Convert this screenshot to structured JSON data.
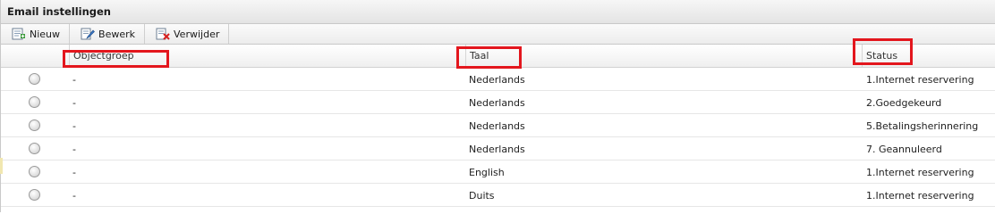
{
  "panel": {
    "title": "Email instellingen"
  },
  "toolbar": {
    "new_label": "Nieuw",
    "edit_label": "Bewerk",
    "delete_label": "Verwijder"
  },
  "columns": {
    "objectgroep": "Objectgroep",
    "taal": "Taal",
    "status": "Status"
  },
  "rows": [
    {
      "objectgroep": "-",
      "taal": "Nederlands",
      "status": "1.Internet reservering"
    },
    {
      "objectgroep": "-",
      "taal": "Nederlands",
      "status": "2.Goedgekeurd"
    },
    {
      "objectgroep": "-",
      "taal": "Nederlands",
      "status": "5.Betalingsherinnering"
    },
    {
      "objectgroep": "-",
      "taal": "Nederlands",
      "status": "7. Geannuleerd"
    },
    {
      "objectgroep": "-",
      "taal": "English",
      "status": "1.Internet reservering"
    },
    {
      "objectgroep": "-",
      "taal": "Duits",
      "status": "1.Internet reservering"
    }
  ],
  "colors": {
    "highlight": "#e3161d"
  }
}
